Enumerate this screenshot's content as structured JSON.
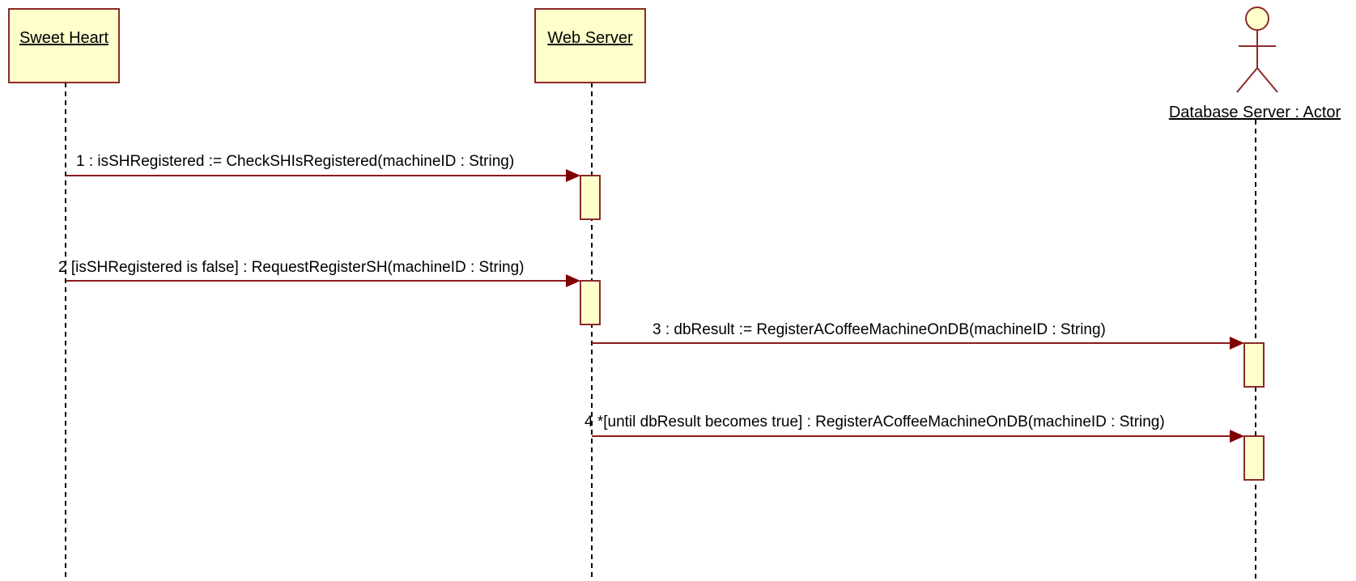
{
  "diagram": {
    "participants": [
      {
        "id": "sweet-heart",
        "label": "Sweet Heart",
        "kind": "object"
      },
      {
        "id": "web-server",
        "label": "Web Server",
        "kind": "object"
      },
      {
        "id": "database-server",
        "label": "Database Server : Actor",
        "kind": "actor"
      }
    ],
    "messages": [
      {
        "label": "1 : isSHRegistered := CheckSHIsRegistered(machineID : String)",
        "from": "sweet-heart",
        "to": "web-server"
      },
      {
        "label": "2 [isSHRegistered is false] : RequestRegisterSH(machineID : String)",
        "from": "sweet-heart",
        "to": "web-server"
      },
      {
        "label": "3 : dbResult := RegisterACoffeeMachineOnDB(machineID : String)",
        "from": "web-server",
        "to": "database-server"
      },
      {
        "label": "4 *[until dbResult becomes true] : RegisterACoffeeMachineOnDB(machineID : String)",
        "from": "web-server",
        "to": "database-server"
      }
    ],
    "colors": {
      "box_fill": "#ffffcc",
      "box_stroke": "#8b2a2a",
      "message_line": "#8b1a1a",
      "arrowhead": "#800000"
    }
  }
}
